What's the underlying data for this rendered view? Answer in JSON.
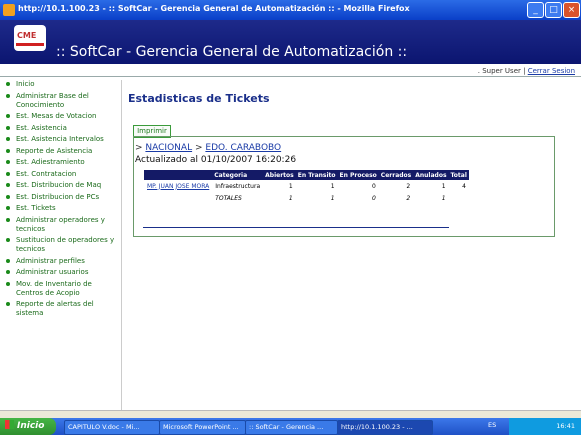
{
  "window": {
    "title": "http://10.1.100.23 - :: SoftCar - Gerencia General de Automatización :: - Mozilla Firefox",
    "minimize": "_",
    "maximize": "□",
    "close": "×"
  },
  "header": {
    "logo_text": "CME",
    "title": ":: SoftCar - Gerencia General de Automatización ::"
  },
  "userbar": {
    "user": ". Super User",
    "sep": "|",
    "logout": "Cerrar Sesion"
  },
  "sidebar": {
    "items": [
      {
        "label": "Inicio"
      },
      {
        "label": "Administrar Base del Conocimiento"
      },
      {
        "label": "Est. Mesas de Votacion"
      },
      {
        "label": "Est. Asistencia"
      },
      {
        "label": "Est. Asistencia Intervalos"
      },
      {
        "label": "Reporte de Asistencia"
      },
      {
        "label": "Est. Adiestramiento"
      },
      {
        "label": "Est. Contratacion"
      },
      {
        "label": "Est. Distribucion de Maq"
      },
      {
        "label": "Est. Distribucion de PCs"
      },
      {
        "label": "Est. Tickets"
      },
      {
        "label": "Administrar operadores y tecnicos"
      },
      {
        "label": "Sustitucion de operadores y tecnicos"
      },
      {
        "label": "Administrar perfiles"
      },
      {
        "label": "Administrar usuarios"
      },
      {
        "label": "Mov. de Inventario de Centros de Acopio"
      },
      {
        "label": "Reporte de alertas del sistema"
      }
    ]
  },
  "main": {
    "title": "Estadisticas de Tickets",
    "print_label": "Imprimir",
    "breadcrumb": {
      "prefix": ">",
      "nacional": "NACIONAL",
      "sep": ">",
      "edo": "EDO. CARABOBO"
    },
    "updated": "Actualizado al 01/10/2007 16:20:26",
    "table": {
      "headers": [
        "",
        "Categoria",
        "Abiertos",
        "En Transito",
        "En Proceso",
        "Cerrados",
        "Anulados",
        "Total"
      ],
      "row": [
        "MP. JUAN JOSE MORA",
        "Infraestructura",
        "1",
        "1",
        "0",
        "2",
        "1",
        "4"
      ],
      "totals": [
        "",
        "TOTALES",
        "1",
        "1",
        "0",
        "2",
        "1",
        ""
      ]
    }
  },
  "taskbar": {
    "start": "Inicio",
    "items": [
      {
        "label": "CAPITULO V.doc - Mi..."
      },
      {
        "label": "Microsoft PowerPoint ..."
      },
      {
        "label": ":: SoftCar - Gerencia ..."
      },
      {
        "label": "http://10.1.100.23 - ..."
      }
    ],
    "lang": "ES",
    "clock": "16:41"
  }
}
